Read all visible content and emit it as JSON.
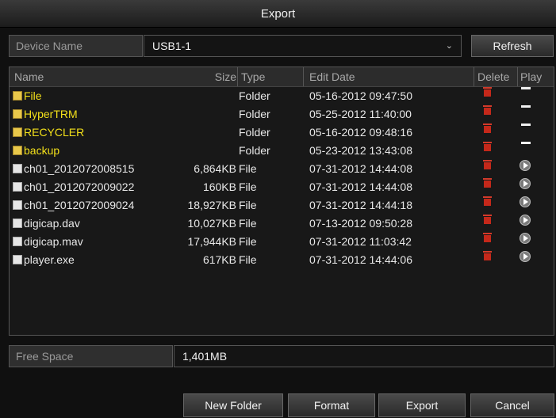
{
  "window": {
    "title": "Export"
  },
  "device": {
    "label": "Device Name",
    "value": "USB1-1",
    "refresh_label": "Refresh"
  },
  "list": {
    "headers": {
      "name": "Name",
      "size": "Size",
      "type": "Type",
      "edit_date": "Edit Date",
      "delete": "Delete",
      "play": "Play"
    },
    "rows": [
      {
        "name": "File",
        "size": "",
        "type": "Folder",
        "edit_date": "05-16-2012 09:47:50",
        "kind": "folder"
      },
      {
        "name": "HyperTRM",
        "size": "",
        "type": "Folder",
        "edit_date": "05-25-2012 11:40:00",
        "kind": "folder"
      },
      {
        "name": "RECYCLER",
        "size": "",
        "type": "Folder",
        "edit_date": "05-16-2012 09:48:16",
        "kind": "folder"
      },
      {
        "name": "backup",
        "size": "",
        "type": "Folder",
        "edit_date": "05-23-2012 13:43:08",
        "kind": "folder"
      },
      {
        "name": "ch01_2012072008515",
        "size": "6,864KB",
        "type": "File",
        "edit_date": "07-31-2012 14:44:08",
        "kind": "file"
      },
      {
        "name": "ch01_2012072009022",
        "size": "160KB",
        "type": "File",
        "edit_date": "07-31-2012 14:44:08",
        "kind": "file"
      },
      {
        "name": "ch01_2012072009024",
        "size": "18,927KB",
        "type": "File",
        "edit_date": "07-31-2012 14:44:18",
        "kind": "file"
      },
      {
        "name": "digicap.dav",
        "size": "10,027KB",
        "type": "File",
        "edit_date": "07-13-2012 09:50:28",
        "kind": "file"
      },
      {
        "name": "digicap.mav",
        "size": "17,944KB",
        "type": "File",
        "edit_date": "07-31-2012 11:03:42",
        "kind": "file"
      },
      {
        "name": "player.exe",
        "size": "617KB",
        "type": "File",
        "edit_date": "07-31-2012 14:44:06",
        "kind": "file"
      }
    ]
  },
  "free_space": {
    "label": "Free Space",
    "value": "1,401MB"
  },
  "footer": {
    "new_folder": "New Folder",
    "format": "Format",
    "export": "Export",
    "cancel": "Cancel"
  },
  "colors": {
    "folder_text": "#f3e01a",
    "delete_icon": "#c4281a"
  },
  "icons": {
    "folder": "folder-icon",
    "file": "file-icon",
    "delete": "trash-icon",
    "play": "play-icon",
    "no_play": "dash-icon"
  }
}
